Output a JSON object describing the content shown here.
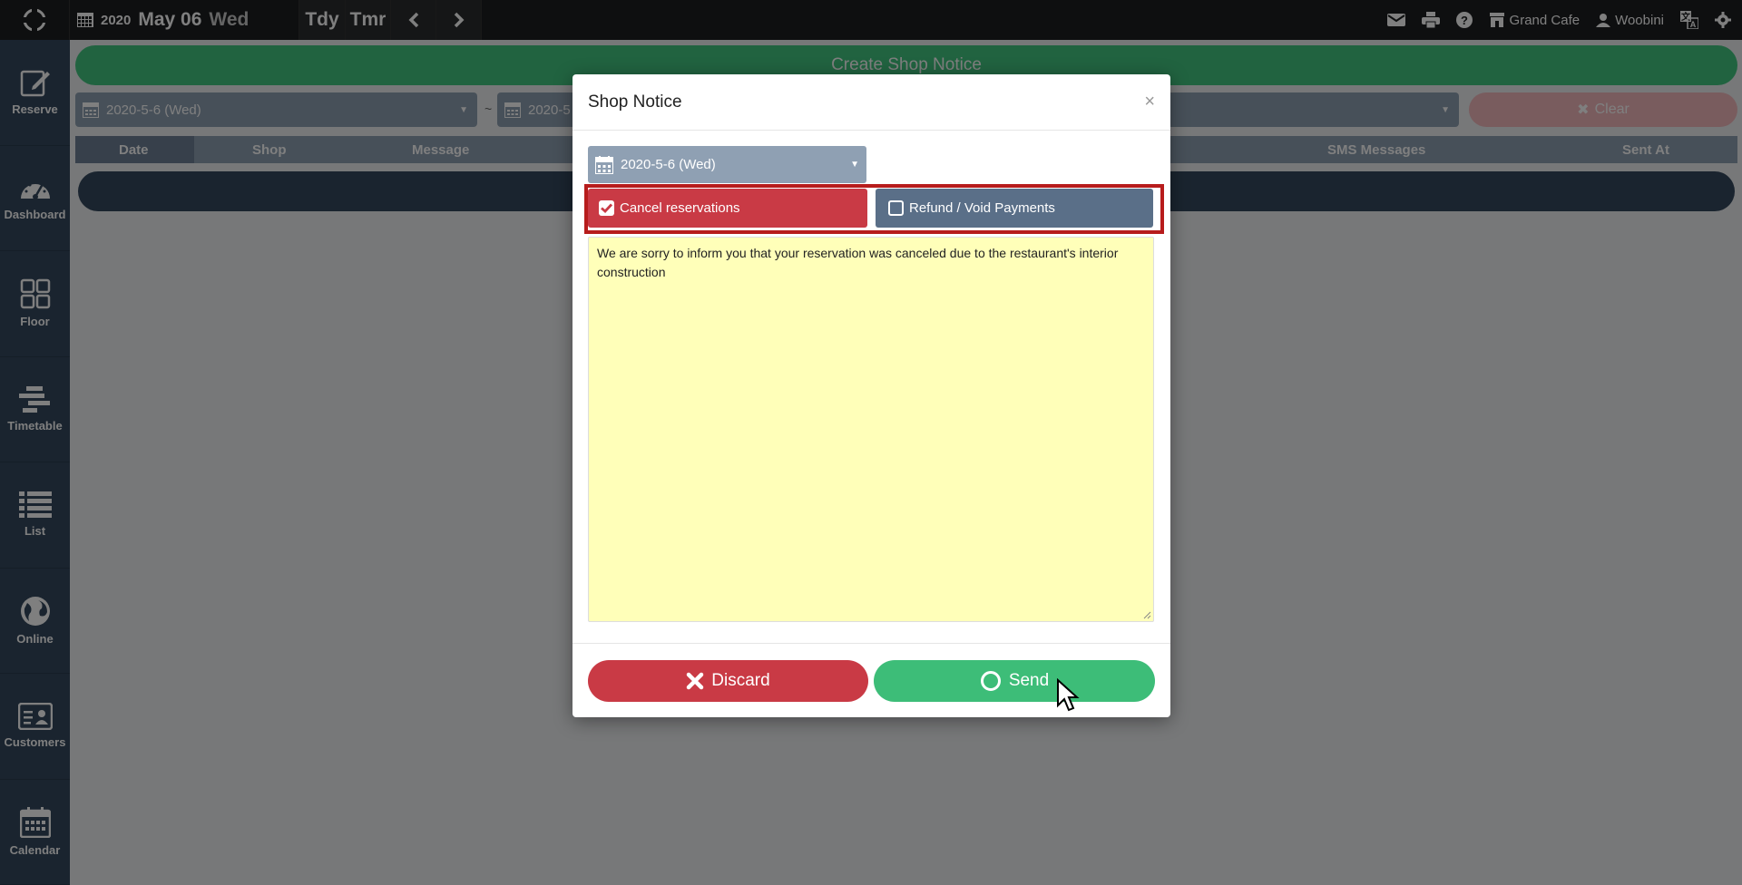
{
  "topbar": {
    "year": "2020",
    "month_day": "May 06",
    "weekday": "Wed",
    "today_label": "Tdy",
    "tomorrow_label": "Tmr",
    "shop_name": "Grand Cafe",
    "user_name": "Woobini"
  },
  "sidebar": {
    "items": [
      {
        "label": "Reserve",
        "icon": "edit-icon"
      },
      {
        "label": "Dashboard",
        "icon": "gauge-icon"
      },
      {
        "label": "Floor",
        "icon": "grid-icon"
      },
      {
        "label": "Timetable",
        "icon": "timetable-icon"
      },
      {
        "label": "List",
        "icon": "list-icon"
      },
      {
        "label": "Online",
        "icon": "globe-icon"
      },
      {
        "label": "Customers",
        "icon": "id-card-icon"
      },
      {
        "label": "Calendar",
        "icon": "calendar-icon"
      }
    ]
  },
  "main": {
    "create_label": "Create Shop Notice",
    "from_date": "2020-5-6 (Wed)",
    "to_date": "2020-5",
    "separator": "~",
    "clear_label": "Clear",
    "columns": [
      "Date",
      "Shop",
      "Message",
      "SMS Messages",
      "Sent At"
    ]
  },
  "modal": {
    "title": "Shop Notice",
    "close": "×",
    "date_value": "2020-5-6 (Wed)",
    "cancel_option": "Cancel reservations",
    "cancel_checked": true,
    "refund_option": "Refund / Void Payments",
    "refund_checked": false,
    "message": "We are sorry to inform you that your reservation was canceled due to the restaurant's interior construction",
    "discard_label": "Discard",
    "send_label": "Send"
  },
  "colors": {
    "topbar": "#1d1f21",
    "sidebar": "#34495e",
    "primary_green": "#3dbd78",
    "danger_red": "#c93a45",
    "slate": "#5a6f88",
    "message_bg": "#ffffb9",
    "highlight": "#b71c1c"
  }
}
